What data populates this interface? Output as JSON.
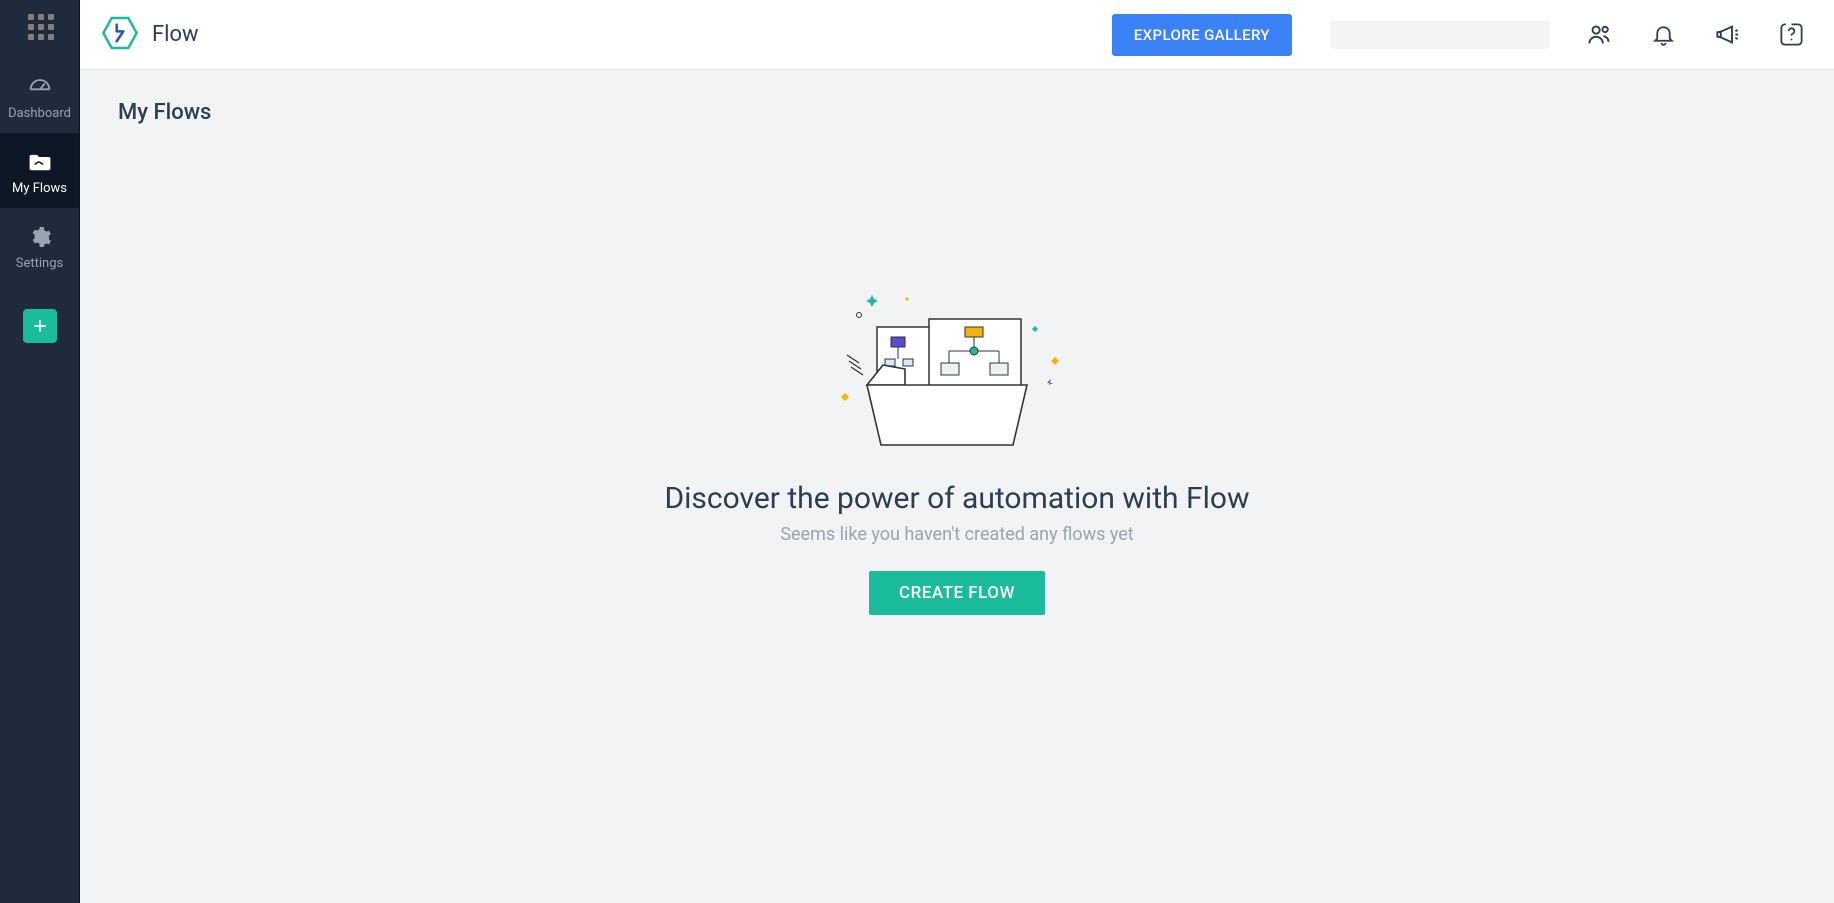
{
  "app": {
    "title": "Flow"
  },
  "topbar": {
    "explore_label": "EXPLORE GALLERY"
  },
  "sidebar": {
    "items": [
      {
        "key": "dashboard",
        "label": "Dashboard"
      },
      {
        "key": "myflows",
        "label": "My Flows"
      },
      {
        "key": "settings",
        "label": "Settings"
      }
    ],
    "active_key": "myflows"
  },
  "page": {
    "title": "My Flows"
  },
  "empty_state": {
    "heading": "Discover the power of automation with Flow",
    "subtext": "Seems like you haven't created any flows yet",
    "create_label": "CREATE FLOW"
  },
  "icons": {
    "app_switcher": "app-grid-icon",
    "dashboard": "gauge-icon",
    "myflows": "folder-flow-icon",
    "settings": "gear-icon",
    "add": "plus-icon",
    "users": "users-icon",
    "bell": "bell-icon",
    "announce": "megaphone-icon",
    "help": "help-icon",
    "logo": "flow-hexagon-icon"
  },
  "colors": {
    "primary_blue": "#3b82f6",
    "primary_green": "#1abc9c",
    "sidebar_bg": "#1f2a3a",
    "sidebar_active_bg": "#0e1726",
    "content_bg": "#f2f3f5",
    "text_dark": "#2c3e50",
    "text_muted": "#9aa3af"
  }
}
